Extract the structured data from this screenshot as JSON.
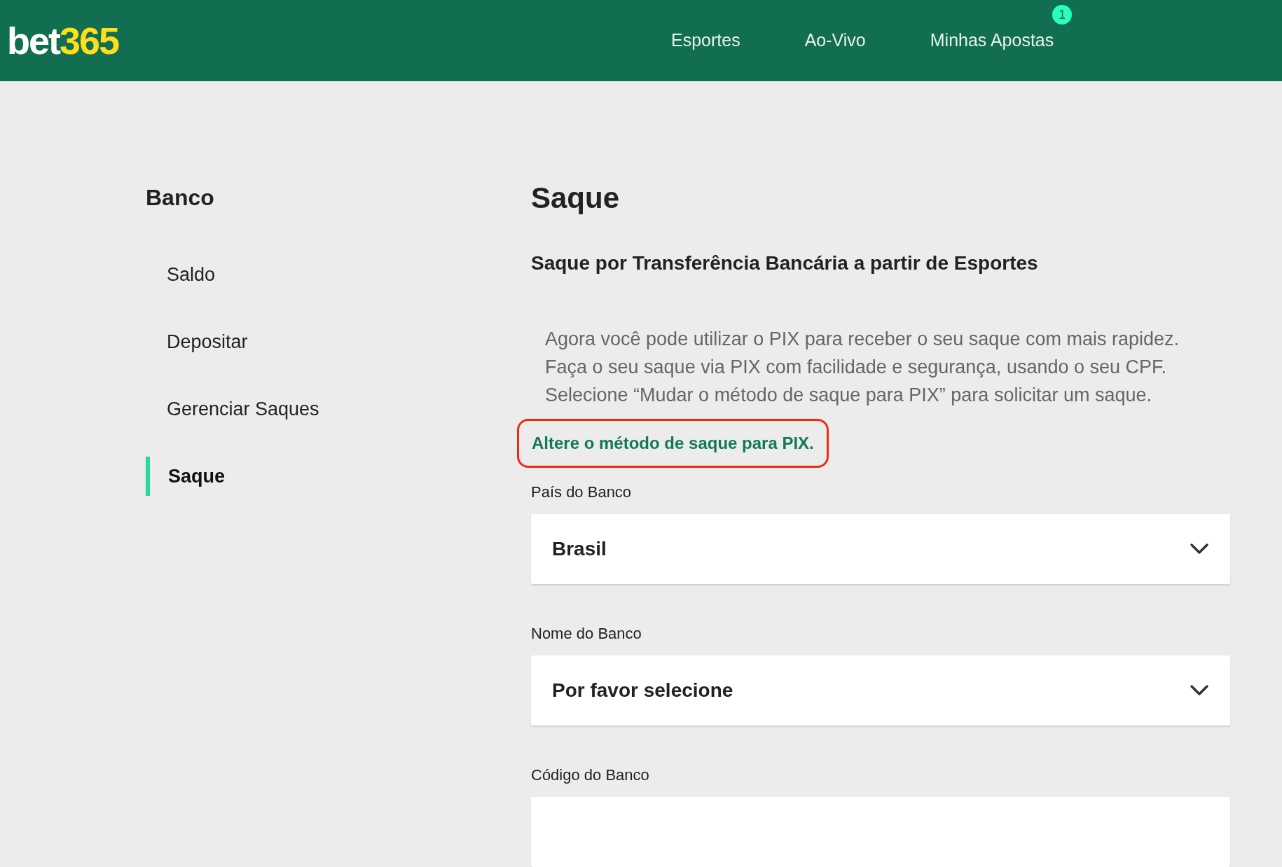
{
  "header": {
    "logo": {
      "part_1": "bet",
      "part_2": "365"
    },
    "nav": [
      {
        "label": "Esportes"
      },
      {
        "label": "Ao-Vivo"
      },
      {
        "label": "Minhas Apostas",
        "badge": "1"
      }
    ]
  },
  "sidebar": {
    "title": "Banco",
    "items": [
      {
        "label": "Saldo",
        "selected": false
      },
      {
        "label": "Depositar",
        "selected": false
      },
      {
        "label": "Gerenciar Saques",
        "selected": false
      },
      {
        "label": "Saque",
        "selected": true
      }
    ]
  },
  "main": {
    "title": "Saque",
    "subtitle": "Saque por Transferência Bancária a partir de Esportes",
    "info": [
      "Agora você pode utilizar o PIX para receber o seu saque com mais rapidez.",
      "Faça o seu saque via PIX com facilidade e segurança, usando o seu CPF. Selecione “Mudar o método de saque para PIX” para solicitar um saque."
    ],
    "link": {
      "label": "Altere o método de saque para PIX.",
      "highlighted": true
    },
    "fields": [
      {
        "kind": "select",
        "label": "País do Banco",
        "value": "Brasil"
      },
      {
        "kind": "select",
        "label": "Nome do Banco",
        "value": "Por favor selecione"
      },
      {
        "kind": "text",
        "label": "Código do Banco"
      }
    ]
  }
}
